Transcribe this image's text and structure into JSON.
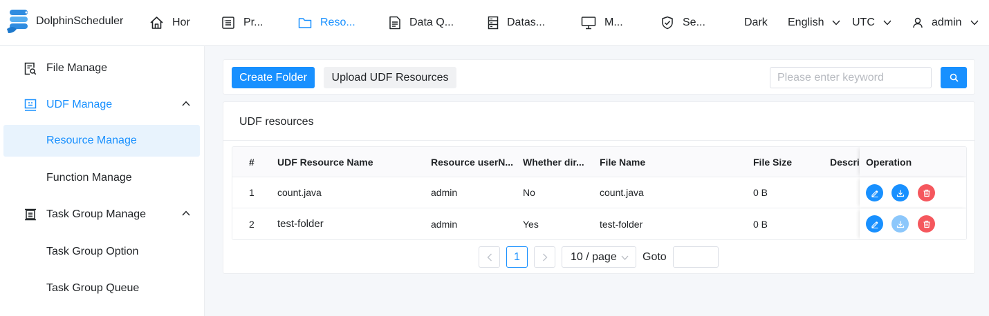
{
  "header": {
    "logo_text": "DolphinScheduler",
    "nav": [
      {
        "label": "Hor"
      },
      {
        "label": "Pr..."
      },
      {
        "label": "Reso..."
      },
      {
        "label": "Data Q..."
      },
      {
        "label": "Datas..."
      },
      {
        "label": "M..."
      },
      {
        "label": "Se..."
      }
    ],
    "theme": "Dark",
    "language": "English",
    "timezone": "UTC",
    "user": "admin"
  },
  "sidebar": {
    "items": [
      {
        "label": "File Manage"
      },
      {
        "label": "UDF Manage"
      },
      {
        "label": "Resource Manage"
      },
      {
        "label": "Function Manage"
      },
      {
        "label": "Task Group Manage"
      },
      {
        "label": "Task Group Option"
      },
      {
        "label": "Task Group Queue"
      }
    ]
  },
  "toolbar": {
    "create_folder": "Create Folder",
    "upload_udf": "Upload UDF Resources",
    "search_placeholder": "Please enter keyword"
  },
  "card": {
    "title": "UDF resources"
  },
  "table": {
    "columns": [
      "#",
      "UDF Resource Name",
      "Resource userN...",
      "Whether dir...",
      "File Name",
      "File Size",
      "Descrip",
      "Operation"
    ],
    "rows": [
      {
        "index": "1",
        "name": "count.java",
        "user": "admin",
        "is_dir": "No",
        "file_name": "count.java",
        "size": "0 B",
        "desc": ""
      },
      {
        "index": "2",
        "name": "test-folder",
        "user": "admin",
        "is_dir": "Yes",
        "file_name": "test-folder",
        "size": "0 B",
        "desc": ""
      }
    ]
  },
  "pagination": {
    "current_page": "1",
    "page_size": "10 / page",
    "goto_label": "Goto"
  },
  "colors": {
    "primary": "#1890ff",
    "danger": "#f5575d",
    "selected_bg": "#e8f3fd"
  }
}
